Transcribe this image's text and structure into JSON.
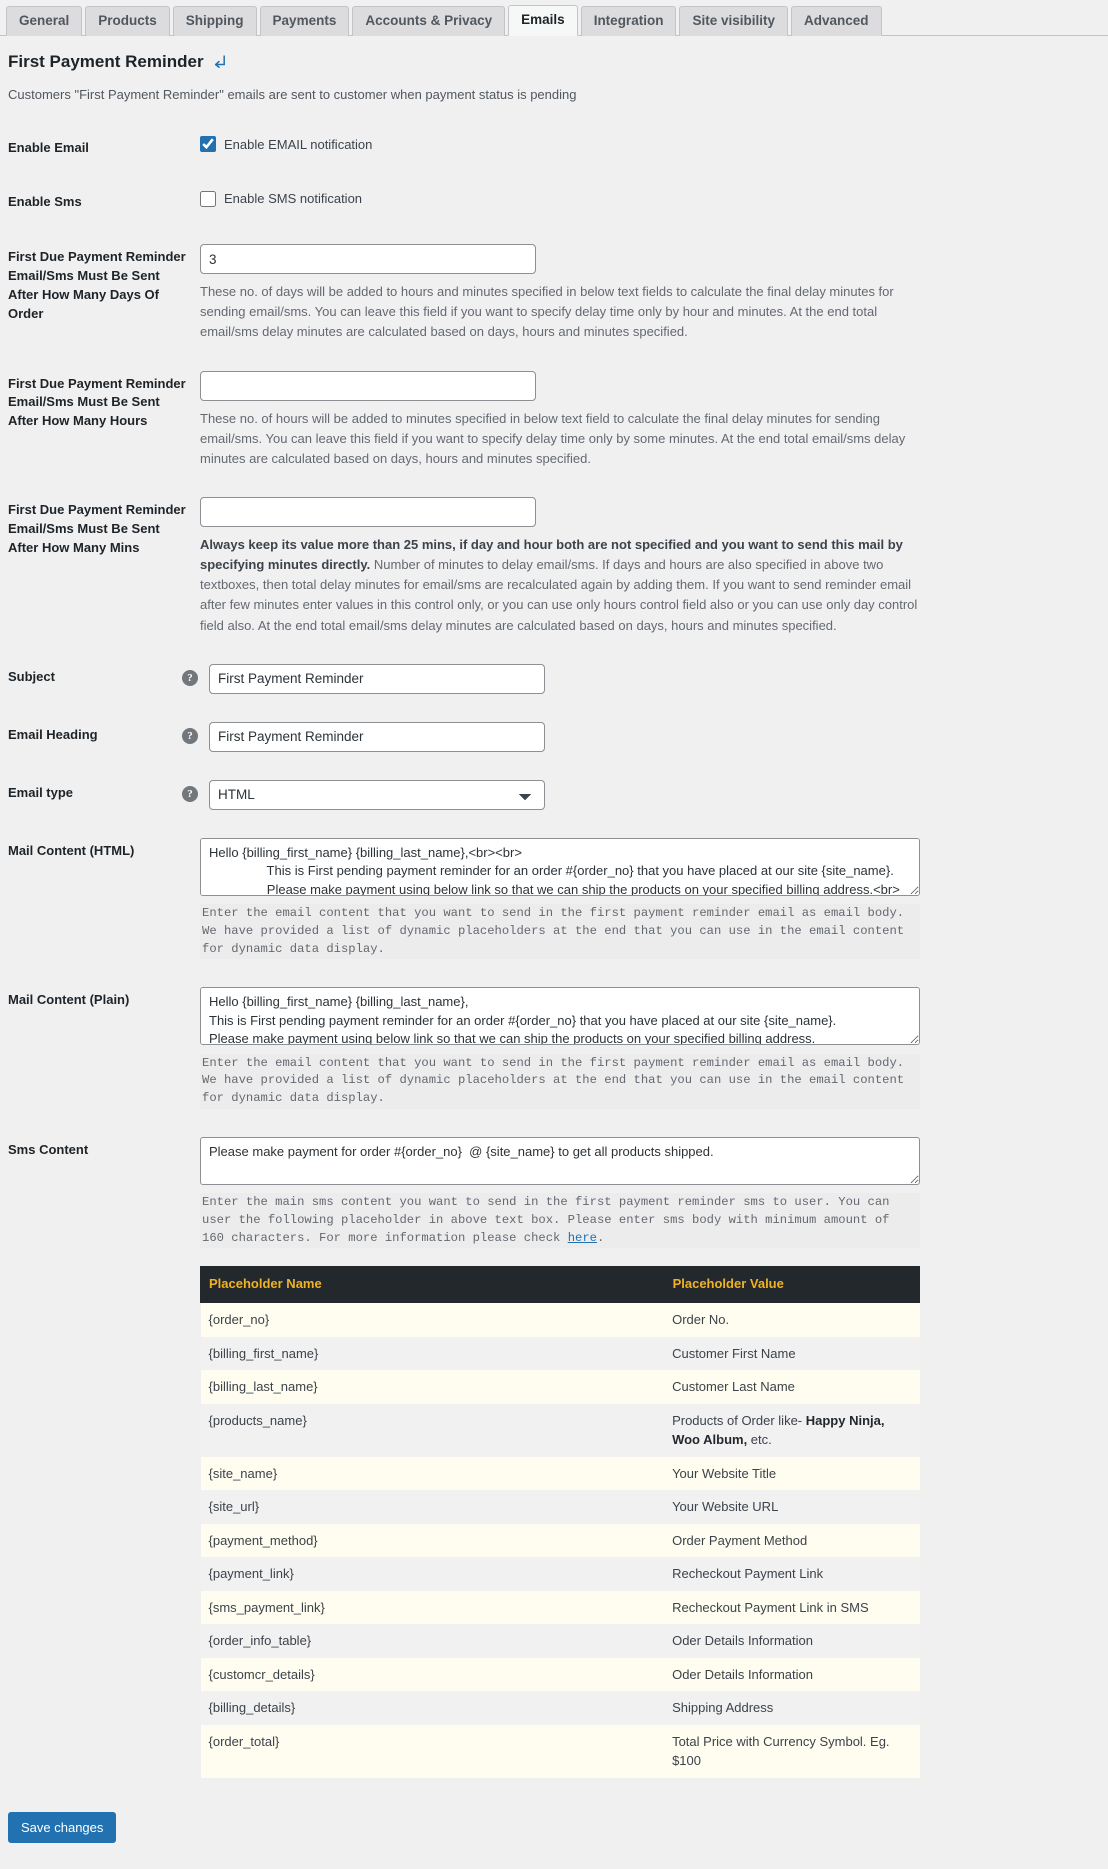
{
  "nav": {
    "tabs": [
      {
        "label": "General",
        "active": false
      },
      {
        "label": "Products",
        "active": false
      },
      {
        "label": "Shipping",
        "active": false
      },
      {
        "label": "Payments",
        "active": false
      },
      {
        "label": "Accounts & Privacy",
        "active": false
      },
      {
        "label": "Emails",
        "active": true
      },
      {
        "label": "Integration",
        "active": false
      },
      {
        "label": "Site visibility",
        "active": false
      },
      {
        "label": "Advanced",
        "active": false
      }
    ]
  },
  "header": {
    "title": "First Payment Reminder",
    "back_icon": "return-arrow-icon",
    "description": "Customers \"First Payment Reminder\" emails are sent to customer when payment status is pending"
  },
  "fields": {
    "enable_email": {
      "label": "Enable Email",
      "checkbox_label": "Enable EMAIL notification",
      "checked": true
    },
    "enable_sms": {
      "label": "Enable Sms",
      "checkbox_label": "Enable SMS notification",
      "checked": false
    },
    "days": {
      "label": "First Due Payment Reminder Email/Sms Must Be Sent After How Many Days Of Order",
      "value": "3",
      "desc": "These no. of days will be added to hours and minutes specified in below text fields to calculate the final delay minutes for sending email/sms. You can leave this field if you want to specify delay time only by hour and minutes. At the end total email/sms delay minutes are calculated based on days, hours and minutes specified."
    },
    "hours": {
      "label": "First Due Payment Reminder Email/Sms Must Be Sent After How Many Hours",
      "value": "",
      "desc": "These no. of hours will be added to minutes specified in below text field to calculate the final delay minutes for sending email/sms. You can leave this field if you want to specify delay time only by some minutes. At the end total email/sms delay minutes are calculated based on days, hours and minutes specified."
    },
    "mins": {
      "label": "First Due Payment Reminder Email/Sms Must Be Sent After How Many Mins",
      "value": "",
      "desc_bold": "Always keep its value more than 25 mins, if day and hour both are not specified and you want to send this mail by specifying minutes directly.",
      "desc_rest": " Number of minutes to delay email/sms. If days and hours are also specified in above two textboxes, then total delay minutes for email/sms are recalculated again by adding them. If you want to send reminder email after few minutes enter values in this control only, or you can use only hours control field also or you can use only day control field also. At the end total email/sms delay minutes are calculated based on days, hours and minutes specified."
    },
    "subject": {
      "label": "Subject",
      "value": "First Payment Reminder",
      "help_icon": "question-mark-icon"
    },
    "email_heading": {
      "label": "Email Heading",
      "value": "First Payment Reminder",
      "help_icon": "question-mark-icon"
    },
    "email_type": {
      "label": "Email type",
      "value": "HTML",
      "options": [
        "HTML"
      ],
      "help_icon": "question-mark-icon"
    },
    "mail_content_html": {
      "label": "Mail Content (HTML)",
      "value": "Hello {billing_first_name} {billing_last_name},<br><br>\n                This is First pending payment reminder for an order #{order_no} that you have placed at our site {site_name}.\n                Please make payment using below link so that we can ship the products on your specified billing address.<br>",
      "desc": "Enter the email content that you want to send in the first payment reminder email as email body. We have provided a list of dynamic placeholders at the end that you can use in the email content for dynamic data display."
    },
    "mail_content_plain": {
      "label": "Mail Content (Plain)",
      "value": "Hello {billing_first_name} {billing_last_name},\nThis is First pending payment reminder for an order #{order_no} that you have placed at our site {site_name}.\nPlease make payment using below link so that we can ship the products on your specified billing address.",
      "desc": "Enter the email content that you want to send in the first payment reminder email as email body. We have provided a list of dynamic placeholders at the end that you can use in the email content for dynamic data display."
    },
    "sms_content": {
      "label": "Sms Content",
      "value": "Please make payment for order #{order_no}  @ {site_name} to get all products shipped.",
      "desc_before": " Enter the main sms content you want to send in the first payment reminder sms to user. You can user the following placeholder in above text box. Please enter sms body with minimum amount of 160 characters. For more information please check ",
      "desc_link": "here",
      "desc_after": "."
    }
  },
  "placeholder_table": {
    "headers": [
      "Placeholder Name",
      "Placeholder Value"
    ],
    "rows": [
      {
        "name": "{order_no}",
        "value": "Order No."
      },
      {
        "name": "{billing_first_name}",
        "value": "Customer First Name"
      },
      {
        "name": "{billing_last_name}",
        "value": "Customer Last Name"
      },
      {
        "name": "{products_name}",
        "value_prefix": "Products of Order like- ",
        "value_bold": "Happy Ninja, Woo Album,",
        "value_suffix": " etc."
      },
      {
        "name": "{site_name}",
        "value": "Your Website Title"
      },
      {
        "name": "{site_url}",
        "value": "Your Website URL"
      },
      {
        "name": "{payment_method}",
        "value": "Order Payment Method"
      },
      {
        "name": "{payment_link}",
        "value": "Recheckout Payment Link"
      },
      {
        "name": "{sms_payment_link}",
        "value": "Recheckout Payment Link in SMS"
      },
      {
        "name": "{order_info_table}",
        "value": "Oder Details Information"
      },
      {
        "name": "{customcr_details}",
        "value": "Oder Details Information"
      },
      {
        "name": "{billing_details}",
        "value": "Shipping Address"
      },
      {
        "name": "{order_total}",
        "value": "Total Price with Currency Symbol. Eg. $100"
      }
    ]
  },
  "footer": {
    "save_label": "Save changes"
  },
  "colors": {
    "accent": "#2271b1",
    "table_header_bg": "#23282d",
    "table_header_text": "#f0b323",
    "row_odd": "#fffdf0",
    "row_even": "#f1f1f1"
  }
}
